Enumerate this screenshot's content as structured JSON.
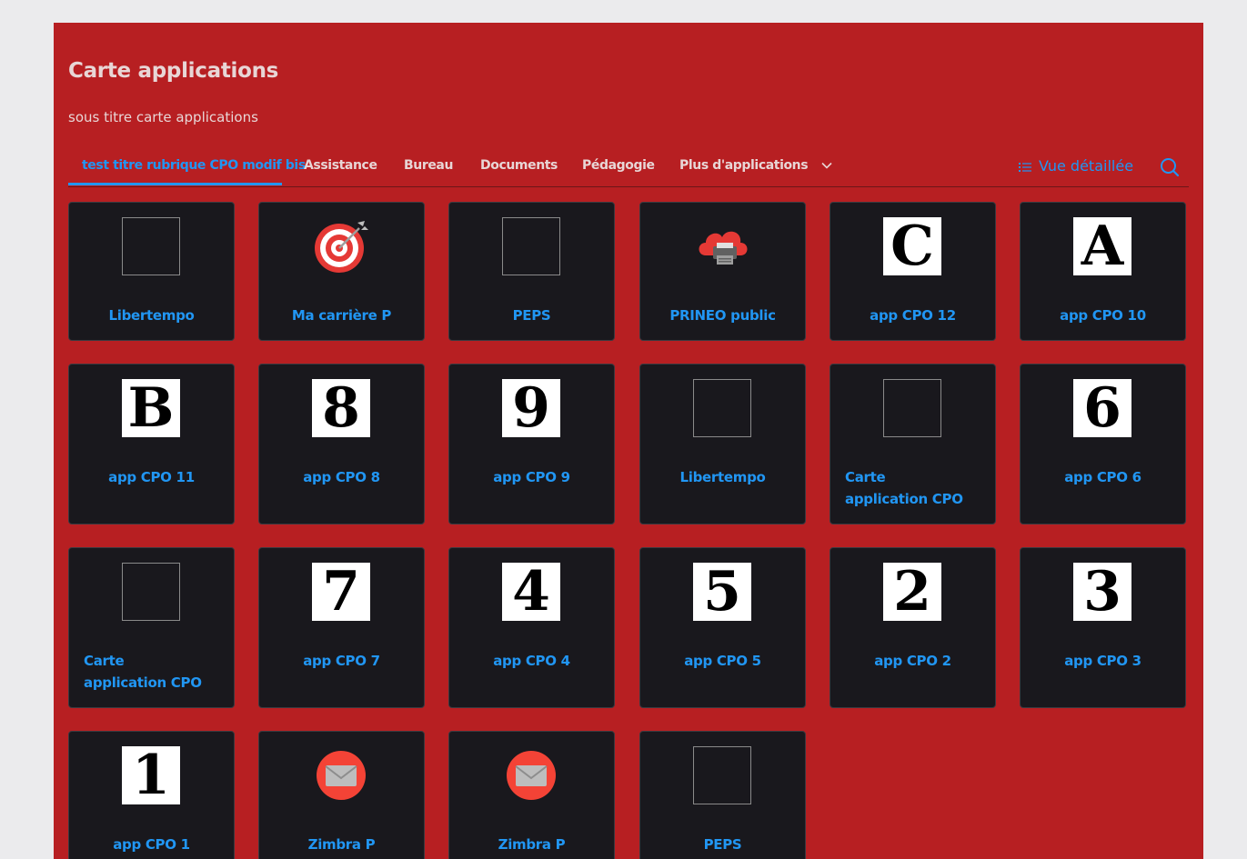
{
  "header": {
    "title": "Carte applications",
    "subtitle": "sous titre carte applications"
  },
  "tabs": [
    {
      "label": "test titre rubrique CPO modif bis",
      "active": true
    },
    {
      "label": "Assistance"
    },
    {
      "label": "Bureau"
    },
    {
      "label": "Documents"
    },
    {
      "label": "Pédagogie"
    },
    {
      "label": "Plus d'applications"
    }
  ],
  "view_toggle": {
    "label": "Vue détaillée",
    "icon": "list-icon"
  },
  "search": {
    "icon": "search-icon"
  },
  "colors": {
    "panel_bg": "#b71f22",
    "card_bg": "#19181d",
    "accent": "#2196f3",
    "header_text": "#e8d6d6"
  },
  "apps": [
    {
      "label": "Libertempo",
      "icon": "blank"
    },
    {
      "label": "Ma carrière P",
      "icon": "target"
    },
    {
      "label": "PEPS",
      "icon": "blank"
    },
    {
      "label": "PRINEO public",
      "icon": "cloud-printer"
    },
    {
      "label": "app CPO 12",
      "icon": "letter",
      "glyph": "C"
    },
    {
      "label": "app CPO 10",
      "icon": "letter",
      "glyph": "A"
    },
    {
      "label": "app CPO 11",
      "icon": "letter",
      "glyph": "B"
    },
    {
      "label": "app CPO 8",
      "icon": "letter",
      "glyph": "8"
    },
    {
      "label": "app CPO 9",
      "icon": "letter",
      "glyph": "9"
    },
    {
      "label": "Libertempo",
      "icon": "blank"
    },
    {
      "label": "Carte application CPO",
      "icon": "blank",
      "align": "left"
    },
    {
      "label": "app CPO 6",
      "icon": "letter",
      "glyph": "6"
    },
    {
      "label": "Carte application CPO",
      "icon": "blank",
      "align": "left"
    },
    {
      "label": "app CPO 7",
      "icon": "letter",
      "glyph": "7"
    },
    {
      "label": "app CPO 4",
      "icon": "letter",
      "glyph": "4"
    },
    {
      "label": "app CPO 5",
      "icon": "letter",
      "glyph": "5"
    },
    {
      "label": "app CPO 2",
      "icon": "letter",
      "glyph": "2"
    },
    {
      "label": "app CPO 3",
      "icon": "letter",
      "glyph": "3"
    },
    {
      "label": "app CPO 1",
      "icon": "letter",
      "glyph": "1"
    },
    {
      "label": "Zimbra P",
      "icon": "mail"
    },
    {
      "label": "Zimbra P",
      "icon": "mail"
    },
    {
      "label": "PEPS",
      "icon": "blank"
    }
  ]
}
